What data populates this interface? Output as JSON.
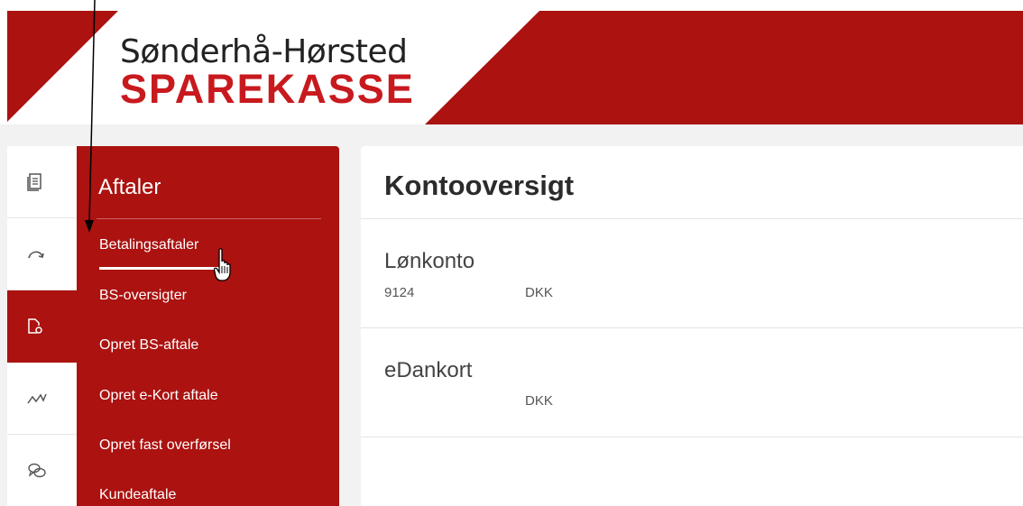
{
  "header": {
    "bank_name_line1": "Sønderhå-Hørsted",
    "bank_name_line2": "SPAREKASSE",
    "brand_color": "#ab1210",
    "logo_red": "#c81a1e"
  },
  "icon_bar": [
    {
      "icon": "document-list-icon",
      "active": false
    },
    {
      "icon": "curved-arrow-icon",
      "active": false
    },
    {
      "icon": "document-settings-icon",
      "active": true
    },
    {
      "icon": "trend-chart-icon",
      "active": false
    },
    {
      "icon": "chat-bubbles-icon",
      "active": false
    }
  ],
  "menu": {
    "title": "Aftaler",
    "items": [
      {
        "label": "Betalingsaftaler",
        "active": true
      },
      {
        "label": "BS-oversigter",
        "active": false
      },
      {
        "label": "Opret BS-aftale",
        "active": false
      },
      {
        "label": "Opret e-Kort aftale",
        "active": false
      },
      {
        "label": "Opret fast overførsel",
        "active": false
      },
      {
        "label": "Kundeaftale",
        "active": false
      }
    ]
  },
  "main": {
    "title": "Kontooversigt",
    "accounts": [
      {
        "name": "Lønkonto",
        "number": "9124",
        "currency": "DKK"
      },
      {
        "name": "eDankort",
        "number": "",
        "currency": "DKK"
      }
    ]
  }
}
